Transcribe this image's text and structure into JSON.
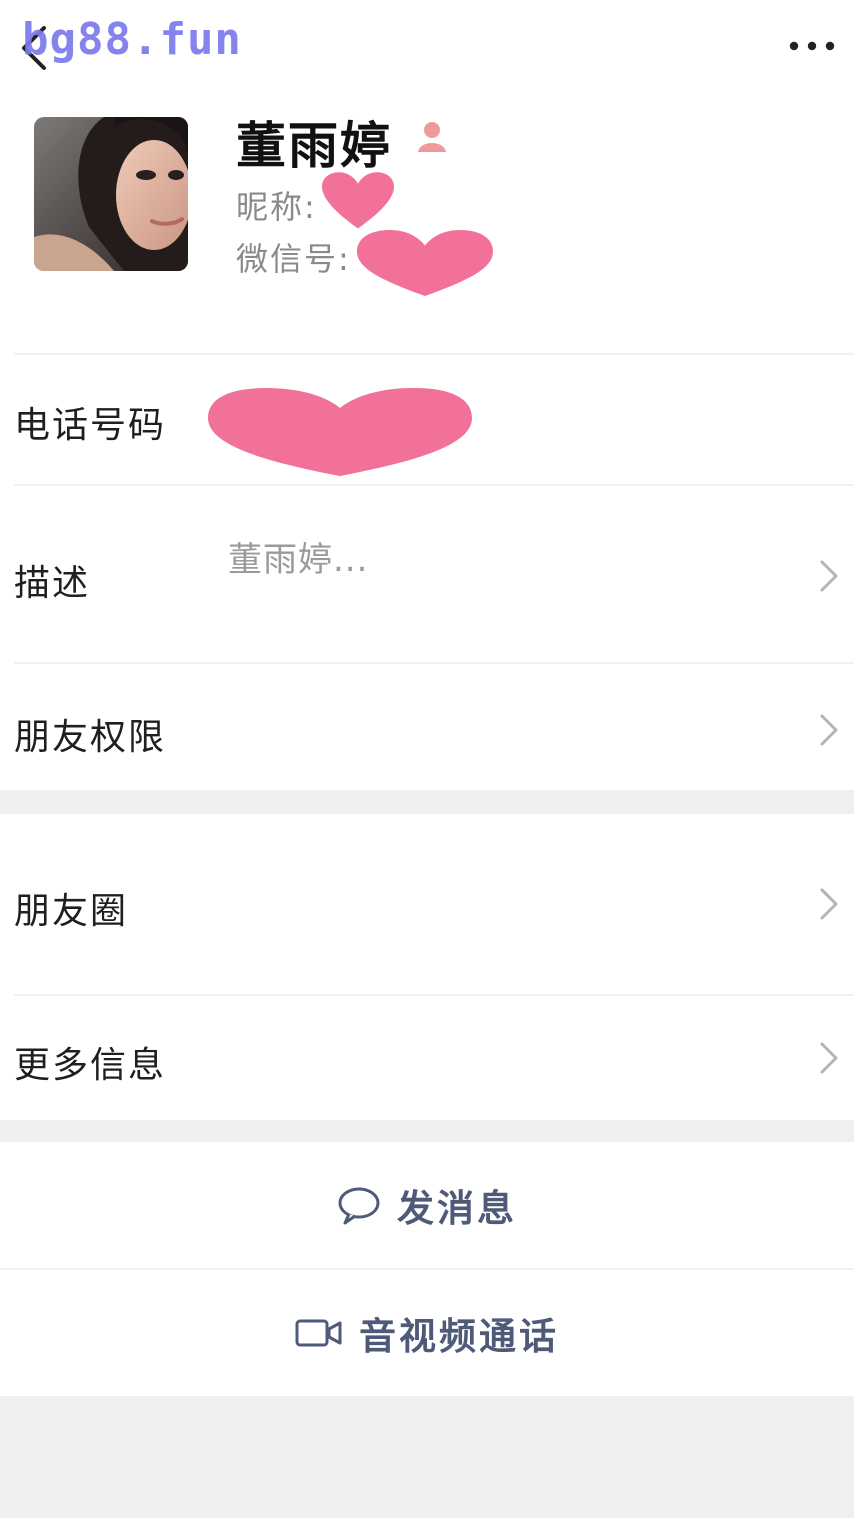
{
  "watermark": "bg88.fun",
  "header": {
    "back_icon": "chevron-left-icon",
    "more_icon": "more-dots-icon"
  },
  "profile": {
    "name": "董雨婷",
    "gender_icon": "female-user-icon",
    "nickname_label": "昵称:",
    "wechat_id_label": "微信号:"
  },
  "rows": {
    "phone": {
      "label": "电话号码"
    },
    "description": {
      "label": "描述",
      "value": "董雨婷..."
    },
    "friend_permissions": {
      "label": "朋友权限"
    },
    "moments": {
      "label": "朋友圈"
    },
    "more_info": {
      "label": "更多信息"
    }
  },
  "actions": {
    "message": {
      "label": "发消息",
      "icon": "chat-bubble-icon"
    },
    "call": {
      "label": "音视频通话",
      "icon": "video-camera-icon"
    }
  },
  "colors": {
    "heart": "#f17199",
    "accent_text": "#4f5a79",
    "watermark": "#7b79ec",
    "gap": "#efefef"
  }
}
